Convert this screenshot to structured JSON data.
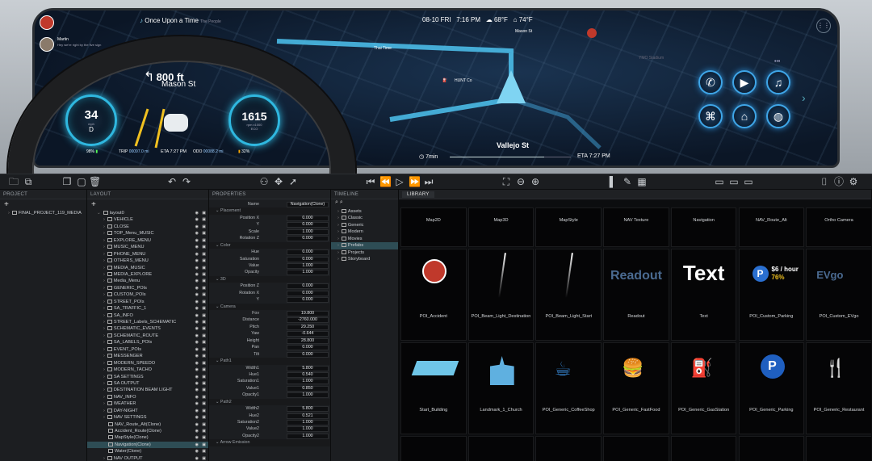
{
  "hud": {
    "driver_name": "Martin",
    "driver_status": "Hey we're right by the five sign",
    "song_title": "Once Upon a Time",
    "song_artist": "The People",
    "date": "08-10 FRI",
    "time": "7:16 PM",
    "weather1": "68°F",
    "weather2": "74°F",
    "turn_distance": "800 ft",
    "turn_street": "Mason St",
    "speed": "34",
    "speed_unit": "mph",
    "gear": "D",
    "rpm": "1615",
    "rpm_unit": "rpm x1000",
    "rpm_sub": "ECO",
    "battery": "98%",
    "trip_label": "TRIP",
    "trip_value": "00097.0 mi",
    "eta_label": "ETA",
    "eta_value": "7:27 PM",
    "odo_label": "ODO",
    "odo_value": "00088.2 mi",
    "fuel": "32%",
    "map_labels": {
      "thai": "Thai Time",
      "hunt": "HUNT Co",
      "mason": "Mason St",
      "vallejo": "Vallejo St",
      "ymo": "YMO Stadium"
    },
    "bottom_duration": "7min",
    "bottom_eta_label": "ETA",
    "bottom_eta_value": "7:27 PM",
    "media_buttons": [
      "phone-icon",
      "play-icon",
      "music-icon",
      "gamepad-icon",
      "home-icon",
      "globe-icon"
    ]
  },
  "panels": {
    "project_title": "PROJECT",
    "layout_title": "LAYOUT",
    "properties_title": "PROPERTIES",
    "timeline_title": "TIMELINE",
    "library_title": "LIBRARY",
    "plus": "+",
    "project_item": "FINAL_PROJECT_119_MEDIA"
  },
  "layout_items": [
    {
      "label": "layout0",
      "root": true
    },
    {
      "label": "VEHICLE"
    },
    {
      "label": "CLOSE"
    },
    {
      "label": "TOP_Menu_MUSIC"
    },
    {
      "label": "EXPLORE_MENU"
    },
    {
      "label": "MUSIC_MENU"
    },
    {
      "label": "PHONE_MENU"
    },
    {
      "label": "OTHERS_MENU"
    },
    {
      "label": "MEDIA_MUSIC"
    },
    {
      "label": "MEDIA_EXPLORE"
    },
    {
      "label": "Media_Menu"
    },
    {
      "label": "GENERIC_POIs"
    },
    {
      "label": "CUSTOM_POIs"
    },
    {
      "label": "STREET_POIs"
    },
    {
      "label": "SA_TRAFFIC_1"
    },
    {
      "label": "SA_INFO"
    },
    {
      "label": "STREET_Labels_SCHEMATIC"
    },
    {
      "label": "SCHEMATIC_EVENTS"
    },
    {
      "label": "SCHEMATIC_ROUTE"
    },
    {
      "label": "SA_LABELS_POIs"
    },
    {
      "label": "EVENT_POIs"
    },
    {
      "label": "MESSENGER"
    },
    {
      "label": "MODERN_SPEEDO"
    },
    {
      "label": "MODERN_TACHO"
    },
    {
      "label": "SA SETTINGS"
    },
    {
      "label": "SA OUTPUT"
    },
    {
      "label": "DESTINATION BEAM LIGHT"
    },
    {
      "label": "NAV_INFO"
    },
    {
      "label": "WEATHER"
    },
    {
      "label": "DAY-NIGHT"
    },
    {
      "label": "NAV SETTINGS"
    },
    {
      "label": "NAV_Route_Alt(Clone)",
      "child": true
    },
    {
      "label": "Accident_Route(Clone)",
      "child": true
    },
    {
      "label": "MapStyle(Clone)",
      "child": true
    },
    {
      "label": "Navigation(Clone)",
      "child": true,
      "selected": true
    },
    {
      "label": "Water(Clone)",
      "child": true
    },
    {
      "label": "NAV OUTPUT"
    }
  ],
  "properties": [
    {
      "k": "Name",
      "v": "Navigation(Clone)",
      "wide": true
    },
    {
      "section": "Placement"
    },
    {
      "k": "Position X",
      "v": "0.000"
    },
    {
      "k": "Y",
      "v": "0.000"
    },
    {
      "k": "Scale",
      "v": "1.000"
    },
    {
      "k": "Rotation Z",
      "v": "0.000"
    },
    {
      "section": "Color"
    },
    {
      "k": "Hue",
      "v": "0.000"
    },
    {
      "k": "Saturation",
      "v": "0.000"
    },
    {
      "k": "Value",
      "v": "1.000"
    },
    {
      "k": "Opacity",
      "v": "1.000"
    },
    {
      "section": "3D"
    },
    {
      "k": "Position Z",
      "v": "0.000"
    },
    {
      "k": "Rotation X",
      "v": "0.000"
    },
    {
      "k": "Y",
      "v": "0.000"
    },
    {
      "section": "Camera"
    },
    {
      "k": "Fov",
      "v": "19.800"
    },
    {
      "k": "Distance",
      "v": "-2760.000"
    },
    {
      "k": "Pitch",
      "v": "29.250"
    },
    {
      "k": "Yaw",
      "v": "-0.644"
    },
    {
      "k": "Height",
      "v": "28.800"
    },
    {
      "k": "Pan",
      "v": "0.000"
    },
    {
      "k": "Tilt",
      "v": "0.000"
    },
    {
      "section": "Path1"
    },
    {
      "k": "Width1",
      "v": "5.800"
    },
    {
      "k": "Hue1",
      "v": "0.540"
    },
    {
      "k": "Saturation1",
      "v": "1.000"
    },
    {
      "k": "Value1",
      "v": "0.850"
    },
    {
      "k": "Opacity1",
      "v": "1.000"
    },
    {
      "section": "Path2"
    },
    {
      "k": "Width2",
      "v": "5.800"
    },
    {
      "k": "Hue2",
      "v": "0.521"
    },
    {
      "k": "Saturation2",
      "v": "1.000"
    },
    {
      "k": "Value2",
      "v": "1.000"
    },
    {
      "k": "Opacity2",
      "v": "1.000"
    },
    {
      "section": "Arrow Emission"
    }
  ],
  "timeline_items": [
    {
      "label": "Assets"
    },
    {
      "label": "Classic"
    },
    {
      "label": "Generic"
    },
    {
      "label": "Modern"
    },
    {
      "label": "Movies"
    },
    {
      "label": "Prefabs",
      "selected": true
    },
    {
      "label": "Projects"
    },
    {
      "label": "Storyboard"
    }
  ],
  "library": {
    "row1": [
      "Map2D",
      "Map3D",
      "MapStyle",
      "NAV Texture",
      "Navigation",
      "NAV_Route_Alt",
      "Ortho Camera"
    ],
    "row2": [
      "POI_Accident",
      "POI_Beam_Light_Destination",
      "POI_Beam_Light_Start",
      "Readout",
      "Text",
      "POI_Custom_Parking",
      "POI_Custom_EVgo"
    ],
    "row3": [
      "Start_Building",
      "Landmark_1_Church",
      "POI_Generic_CoffeeShop",
      "POI_Generic_FastFood",
      "POI_Generic_GasStation",
      "POI_Generic_Parking",
      "POI_Generic_Restaurant"
    ],
    "readout_text": "Readout",
    "text_text": "Text",
    "parking_price": "$6 / hour",
    "parking_pct": "76%",
    "evgo_text": "EVgo",
    "parking_letter": "P"
  },
  "colors": {
    "accent": "#2fb8e0",
    "route": "#4ec3f0",
    "selection": "#2e4d55"
  }
}
